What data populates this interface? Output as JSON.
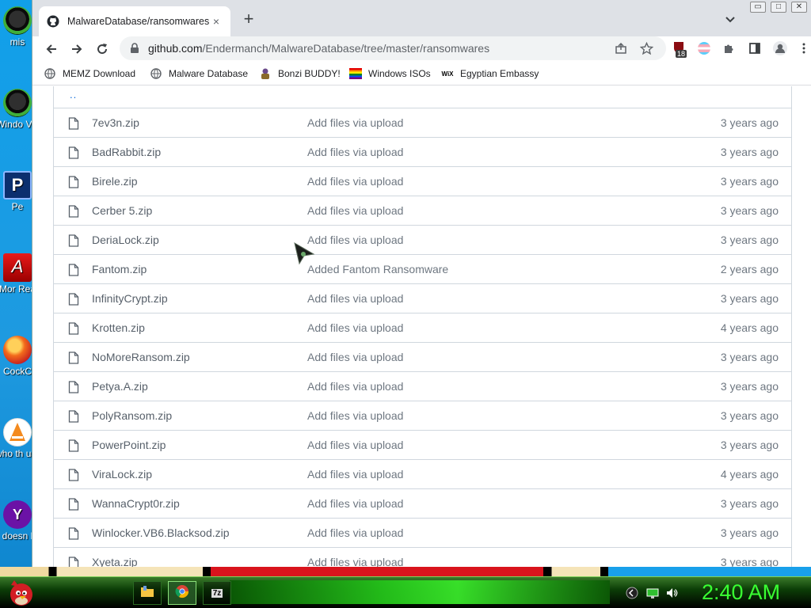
{
  "desktop": {
    "icons": [
      {
        "label": "mis",
        "icon": "green-orb-icon"
      },
      {
        "label": "Windo Vis",
        "icon": "green-orb-icon"
      },
      {
        "label": "Pe",
        "icon": "photoshop-icon"
      },
      {
        "label": "Mor Rea",
        "icon": "acrobat-icon"
      },
      {
        "label": "CockC",
        "icon": "firefox-icon"
      },
      {
        "label": "who th uses",
        "icon": "vlc-icon"
      },
      {
        "label": "doesn l",
        "icon": "yahoo-icon"
      }
    ]
  },
  "browser": {
    "tab": {
      "title": "MalwareDatabase/ransomwares",
      "close": "×"
    },
    "new_tab": "+",
    "window_controls": [
      "▭",
      "□",
      "✕"
    ],
    "url": {
      "host": "github.com",
      "path": "/Endermanch/MalwareDatabase/tree/master/ransomwares"
    },
    "extension_badge": "18",
    "bookmarks": [
      {
        "label": "MEMZ Download",
        "icon": "globe-icon"
      },
      {
        "label": "Malware Database",
        "icon": "globe-icon"
      },
      {
        "label": "Bonzi BUDDY!",
        "icon": "bonzi-icon"
      },
      {
        "label": "Windows ISOs",
        "icon": "rainbow-flag-icon"
      },
      {
        "label": "Egyptian Embassy",
        "icon": "wix-icon"
      }
    ]
  },
  "files": {
    "parent_link": "..",
    "rows": [
      {
        "name": "7ev3n.zip",
        "message": "Add files via upload",
        "age": "3 years ago"
      },
      {
        "name": "BadRabbit.zip",
        "message": "Add files via upload",
        "age": "3 years ago"
      },
      {
        "name": "Birele.zip",
        "message": "Add files via upload",
        "age": "3 years ago"
      },
      {
        "name": "Cerber 5.zip",
        "message": "Add files via upload",
        "age": "3 years ago"
      },
      {
        "name": "DeriaLock.zip",
        "message": "Add files via upload",
        "age": "3 years ago"
      },
      {
        "name": "Fantom.zip",
        "message": "Added Fantom Ransomware",
        "age": "2 years ago"
      },
      {
        "name": "InfinityCrypt.zip",
        "message": "Add files via upload",
        "age": "3 years ago"
      },
      {
        "name": "Krotten.zip",
        "message": "Add files via upload",
        "age": "4 years ago"
      },
      {
        "name": "NoMoreRansom.zip",
        "message": "Add files via upload",
        "age": "3 years ago"
      },
      {
        "name": "Petya.A.zip",
        "message": "Add files via upload",
        "age": "3 years ago"
      },
      {
        "name": "PolyRansom.zip",
        "message": "Add files via upload",
        "age": "3 years ago"
      },
      {
        "name": "PowerPoint.zip",
        "message": "Add files via upload",
        "age": "3 years ago"
      },
      {
        "name": "ViraLock.zip",
        "message": "Add files via upload",
        "age": "4 years ago"
      },
      {
        "name": "WannaCrypt0r.zip",
        "message": "Add files via upload",
        "age": "3 years ago"
      },
      {
        "name": "Winlocker.VB6.Blacksod.zip",
        "message": "Add files via upload",
        "age": "3 years ago"
      },
      {
        "name": "Xyeta.zip",
        "message": "Add files via upload",
        "age": "3 years ago"
      }
    ]
  },
  "taskbar": {
    "buttons": [
      {
        "icon": "folder-icon"
      },
      {
        "icon": "chrome-icon"
      },
      {
        "icon": "7zip-icon",
        "label": "7z"
      }
    ],
    "clock": "2:40 AM"
  }
}
